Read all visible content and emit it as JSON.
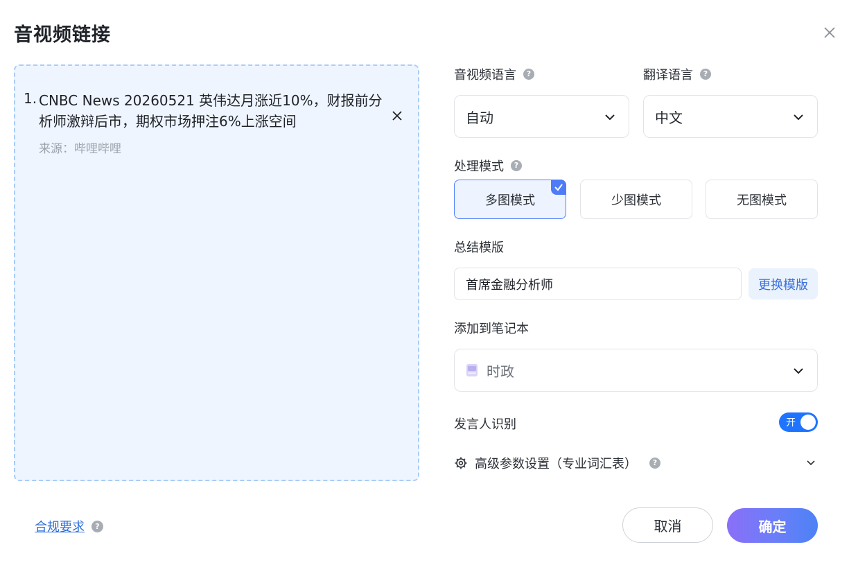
{
  "dialog": {
    "title": "音视频链接"
  },
  "links": [
    {
      "num": "1.",
      "title": "CNBC News 20260521 英伟达月涨近10%，财报前分析师激辩后市，期权市场押注6%上涨空间",
      "source": "来源：哔哩哔哩"
    }
  ],
  "audio_language": {
    "label": "音视频语言",
    "help": "?",
    "value": "自动"
  },
  "translate_language": {
    "label": "翻译语言",
    "help": "?",
    "value": "中文"
  },
  "process_mode": {
    "label": "处理模式",
    "help": "?",
    "options": [
      "多图模式",
      "少图模式",
      "无图模式"
    ],
    "selected": "多图模式"
  },
  "template": {
    "label": "总结模版",
    "value": "首席金融分析师",
    "change_button": "更换模版"
  },
  "notebook": {
    "label": "添加到笔记本",
    "value": "时政"
  },
  "speaker": {
    "label": "发言人识别",
    "toggle_text": "开",
    "enabled": true
  },
  "advanced": {
    "label": "高级参数设置（专业词汇表）",
    "help": "?"
  },
  "compliance": {
    "link": "合规要求",
    "help": "?"
  },
  "buttons": {
    "cancel": "取消",
    "confirm": "确定"
  },
  "colors": {
    "accent": "#1f74ff",
    "drop_zone_bg": "#eff5ff",
    "selected_border": "#4d7cf6",
    "link": "#2f6fd8"
  },
  "icons": {
    "close": "close-icon",
    "item_close": "close-icon",
    "chevron": "chevron-down-icon",
    "check": "check-icon",
    "notebook": "notebook-icon",
    "gear": "gear-icon",
    "help": "help-icon"
  }
}
